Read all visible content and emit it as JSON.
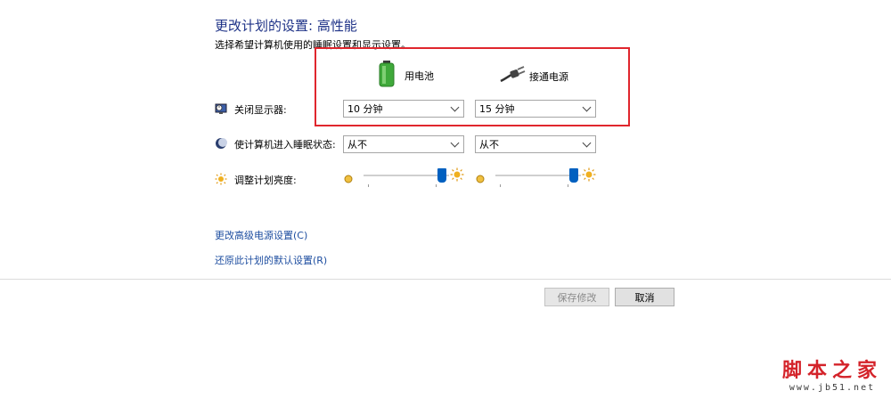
{
  "header": {
    "title": "更改计划的设置: 高性能",
    "subtitle": "选择希望计算机使用的睡眠设置和显示设置。"
  },
  "columns": {
    "battery": {
      "label": "用电池",
      "icon": "battery-icon"
    },
    "plugged": {
      "label": "接通电源",
      "icon": "power-plug-icon"
    }
  },
  "rows": {
    "display": {
      "label": "关闭显示器:",
      "icon": "monitor-clock-icon",
      "battery_value": "10 分钟",
      "plugged_value": "15 分钟"
    },
    "sleep": {
      "label": "使计算机进入睡眠状态:",
      "icon": "moon-icon",
      "battery_value": "从不",
      "plugged_value": "从不"
    },
    "brightness": {
      "label": "调整计划亮度:",
      "icon": "sun-icon",
      "battery_level": 0.92,
      "plugged_level": 0.92
    }
  },
  "links": {
    "advanced": "更改高级电源设置(C)",
    "restore": "还原此计划的默认设置(R)"
  },
  "buttons": {
    "save": "保存修改",
    "cancel": "取消"
  },
  "watermark": {
    "title": "脚本之家",
    "url": "www.jb51.net"
  },
  "colors": {
    "title": "#1e3287",
    "link": "#1e4ea0",
    "highlight_border": "#e0262d",
    "slider_thumb": "#0060c0",
    "watermark": "#d4232a"
  }
}
